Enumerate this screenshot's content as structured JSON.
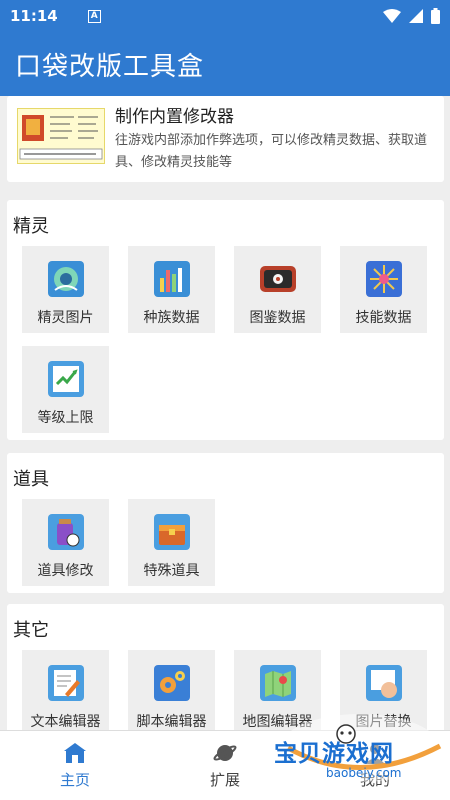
{
  "status": {
    "time": "11:14",
    "notif_icon_letter": "A"
  },
  "app": {
    "title": "口袋改版工具盒"
  },
  "promo": {
    "title": "制作内置修改器",
    "description": "往游戏内部添加作弊选项，可以修改精灵数据、获取道具、修改精灵技能等"
  },
  "sections": {
    "sprites": {
      "title": "精灵",
      "items": [
        "精灵图片",
        "种族数据",
        "图鉴数据",
        "技能数据",
        "等级上限"
      ]
    },
    "items": {
      "title": "道具",
      "items": [
        "道具修改",
        "特殊道具"
      ]
    },
    "others": {
      "title": "其它",
      "items": [
        "文本编辑器",
        "脚本编辑器",
        "地图编辑器",
        "图片替换"
      ]
    }
  },
  "nav": {
    "home": "主页",
    "extend": "扩展",
    "mine": "我的"
  },
  "watermark": {
    "text": "宝贝游戏网",
    "url": "baobeiy.com"
  },
  "colors": {
    "primary": "#2f7ad0",
    "tile_bg": "#eeeeee",
    "page_bg": "#eeeeee"
  }
}
